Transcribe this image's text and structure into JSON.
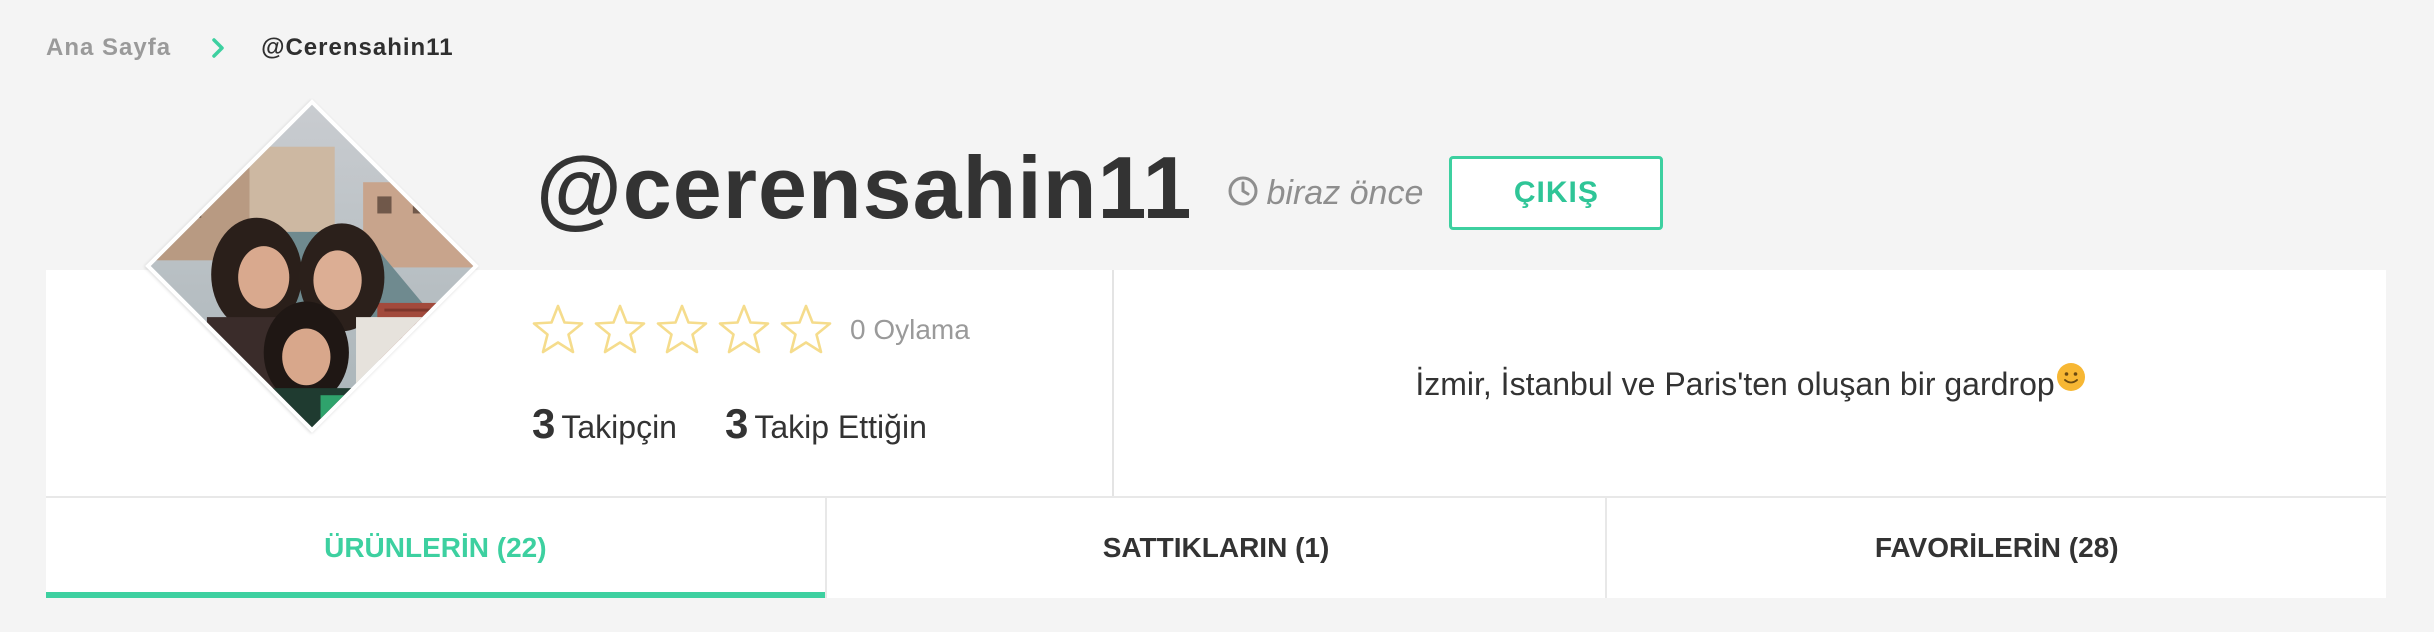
{
  "breadcrumb": {
    "home_label": "Ana Sayfa",
    "current_label": "@Cerensahin11"
  },
  "profile": {
    "username": "@cerensahin11",
    "last_seen": "biraz önce",
    "logout_label": "ÇIKIŞ",
    "rating": {
      "value": 0,
      "max": 5,
      "count_label": "0 Oylama"
    },
    "followers": {
      "count": "3",
      "label": "Takipçin"
    },
    "following": {
      "count": "3",
      "label": "Takip Ettiğin"
    },
    "bio": "İzmir, İstanbul ve Paris'ten oluşan bir gardrop",
    "bio_emoji": "smiley-emoji"
  },
  "tabs": [
    {
      "label": "ÜRÜNLERİN (22)",
      "active": true
    },
    {
      "label": "SATTIKLARIN (1)",
      "active": false
    },
    {
      "label": "FAVORİLERİN (28)",
      "active": false
    }
  ],
  "colors": {
    "accent": "#3dd0a0",
    "star_outline": "#f5dc8c",
    "background": "#f4f4f4"
  },
  "icons": {
    "breadcrumb_separator": "chevron-right-icon",
    "last_seen": "clock-icon",
    "rating": "star-outline-icon"
  }
}
